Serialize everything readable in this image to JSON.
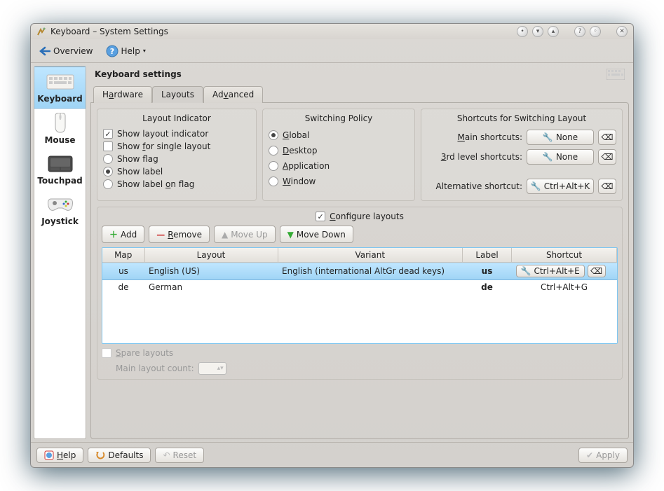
{
  "window": {
    "title": "Keyboard – System Settings"
  },
  "toolbar": {
    "overview": "Overview",
    "help": "Help"
  },
  "sidebar": {
    "items": [
      {
        "label": "Keyboard"
      },
      {
        "label": "Mouse"
      },
      {
        "label": "Touchpad"
      },
      {
        "label": "Joystick"
      }
    ]
  },
  "header": {
    "title": "Keyboard settings"
  },
  "tabs": [
    {
      "label_pre": "H",
      "label_ul": "a",
      "label_post": "rdware"
    },
    {
      "label": "Layouts"
    },
    {
      "label_pre": "Ad",
      "label_ul": "v",
      "label_post": "anced"
    }
  ],
  "indicator": {
    "title": "Layout Indicator",
    "show_indicator": "Show layout indicator",
    "show_single_pre": "Show ",
    "show_single_ul": "f",
    "show_single_post": "or single layout",
    "show_flag": "Show flag",
    "show_label": "Show label",
    "show_label_on_flag_pre": "Show label ",
    "show_label_on_flag_ul": "o",
    "show_label_on_flag_post": "n flag"
  },
  "policy": {
    "title": "Switching Policy",
    "global_ul": "G",
    "global_post": "lobal",
    "desktop_ul": "D",
    "desktop_post": "esktop",
    "application_ul": "A",
    "application_post": "pplication",
    "window_ul": "W",
    "window_post": "indow"
  },
  "shortcuts": {
    "title": "Shortcuts for Switching Layout",
    "main_ul": "M",
    "main_post": "ain shortcuts:",
    "third_ul": "3",
    "third_post": "rd level shortcuts:",
    "alt_label": "Alternative shortcut:",
    "none": "None",
    "alt_value": "Ctrl+Alt+K"
  },
  "config": {
    "configure_ul": "C",
    "configure_post": "onfigure layouts",
    "add": "Add",
    "remove_ul": "R",
    "remove_post": "emove",
    "move_up": "Move Up",
    "move_down": "Move Down",
    "spare_pre": "",
    "spare_ul": "S",
    "spare_post": "pare layouts",
    "main_count": "Main layout count:"
  },
  "table": {
    "headers": {
      "map": "Map",
      "layout": "Layout",
      "variant": "Variant",
      "label": "Label",
      "shortcut": "Shortcut"
    },
    "rows": [
      {
        "map": "us",
        "layout": "English (US)",
        "variant": "English (international AltGr dead keys)",
        "label": "us",
        "shortcut": "Ctrl+Alt+E"
      },
      {
        "map": "de",
        "layout": "German",
        "variant": "",
        "label": "de",
        "shortcut": "Ctrl+Alt+G"
      }
    ]
  },
  "footer": {
    "help_ul": "H",
    "help_post": "elp",
    "defaults": "Defaults",
    "reset": "Reset",
    "apply": "Apply"
  }
}
